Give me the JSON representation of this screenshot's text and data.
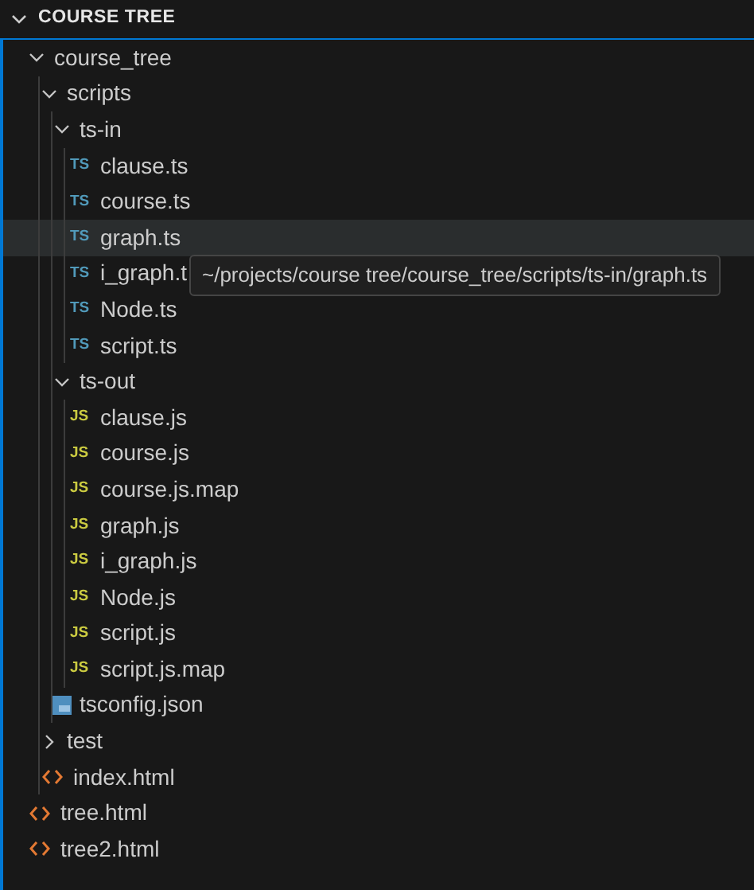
{
  "section": {
    "title": "COURSE TREE",
    "expanded": true
  },
  "tree": [
    {
      "kind": "folder",
      "name": "course_tree",
      "expanded": true,
      "hovered": false,
      "children": [
        {
          "kind": "folder",
          "name": "scripts",
          "expanded": true,
          "hovered": false,
          "children": [
            {
              "kind": "folder",
              "name": "ts-in",
              "expanded": true,
              "hovered": false,
              "children": [
                {
                  "kind": "ts",
                  "badge": "TS",
                  "name": "clause.ts",
                  "hovered": false
                },
                {
                  "kind": "ts",
                  "badge": "TS",
                  "name": "course.ts",
                  "hovered": false
                },
                {
                  "kind": "ts",
                  "badge": "TS",
                  "name": "graph.ts",
                  "hovered": true
                },
                {
                  "kind": "ts",
                  "badge": "TS",
                  "name": "i_graph.t",
                  "hovered": false
                },
                {
                  "kind": "ts",
                  "badge": "TS",
                  "name": "Node.ts",
                  "hovered": false
                },
                {
                  "kind": "ts",
                  "badge": "TS",
                  "name": "script.ts",
                  "hovered": false
                }
              ]
            },
            {
              "kind": "folder",
              "name": "ts-out",
              "expanded": true,
              "hovered": false,
              "children": [
                {
                  "kind": "js",
                  "badge": "JS",
                  "name": "clause.js",
                  "hovered": false
                },
                {
                  "kind": "js",
                  "badge": "JS",
                  "name": "course.js",
                  "hovered": false
                },
                {
                  "kind": "js",
                  "badge": "JS",
                  "name": "course.js.map",
                  "hovered": false
                },
                {
                  "kind": "js",
                  "badge": "JS",
                  "name": "graph.js",
                  "hovered": false
                },
                {
                  "kind": "js",
                  "badge": "JS",
                  "name": "i_graph.js",
                  "hovered": false
                },
                {
                  "kind": "js",
                  "badge": "JS",
                  "name": "Node.js",
                  "hovered": false
                },
                {
                  "kind": "js",
                  "badge": "JS",
                  "name": "script.js",
                  "hovered": false
                },
                {
                  "kind": "js",
                  "badge": "JS",
                  "name": "script.js.map",
                  "hovered": false
                }
              ]
            },
            {
              "kind": "tsconfig",
              "name": "tsconfig.json",
              "hovered": false
            }
          ]
        },
        {
          "kind": "folder",
          "name": "test",
          "expanded": false,
          "hovered": false
        },
        {
          "kind": "html",
          "name": "index.html",
          "hovered": false
        }
      ]
    },
    {
      "kind": "html",
      "name": "tree.html",
      "hovered": false
    },
    {
      "kind": "html",
      "name": "tree2.html",
      "hovered": false
    }
  ],
  "tooltip": {
    "text": "~/projects/course tree/course_tree/scripts/ts-in/graph.ts"
  }
}
